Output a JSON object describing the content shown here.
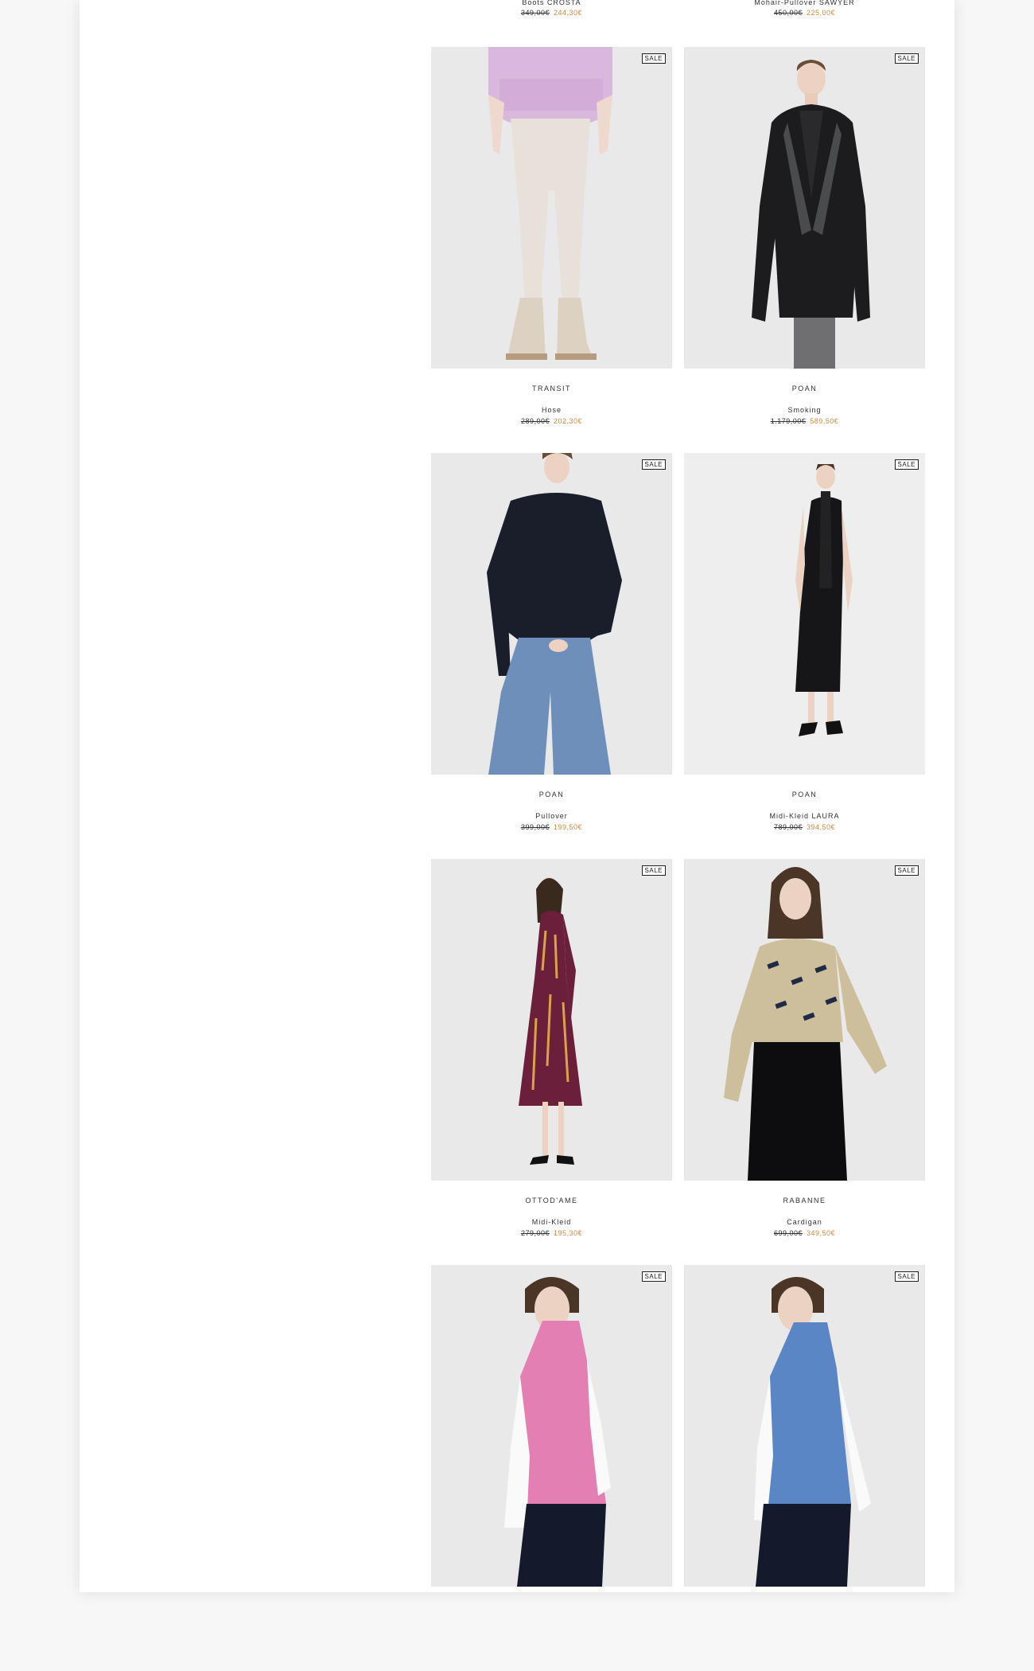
{
  "colors": {
    "sale_price": "#d5893d",
    "background": "#e8e8e8"
  },
  "top_items": [
    {
      "name": "Boots CROSTA",
      "old_price": "349,00€",
      "new_price": "244,30€"
    },
    {
      "name": "Mohair-Pullover SAWYER",
      "old_price": "450,00€",
      "new_price": "225,00€"
    }
  ],
  "sale_badge": "SALE",
  "products": [
    {
      "brand": "TRANSIT",
      "name": "Hose",
      "old_price": "289,00€",
      "new_price": "202,30€"
    },
    {
      "brand": "POAN",
      "name": "Smoking",
      "old_price": "1.179,00€",
      "new_price": "589,50€"
    },
    {
      "brand": "POAN",
      "name": "Pullover",
      "old_price": "399,00€",
      "new_price": "199,50€"
    },
    {
      "brand": "POAN",
      "name": "Midi-Kleid LAURA",
      "old_price": "789,00€",
      "new_price": "394,50€"
    },
    {
      "brand": "OTTOD'AME",
      "name": "Midi-Kleid",
      "old_price": "279,00€",
      "new_price": "195,30€"
    },
    {
      "brand": "RABANNE",
      "name": "Cardigan",
      "old_price": "699,00€",
      "new_price": "349,50€"
    },
    {
      "brand": "",
      "name": "",
      "old_price": "",
      "new_price": ""
    },
    {
      "brand": "",
      "name": "",
      "old_price": "",
      "new_price": ""
    }
  ]
}
